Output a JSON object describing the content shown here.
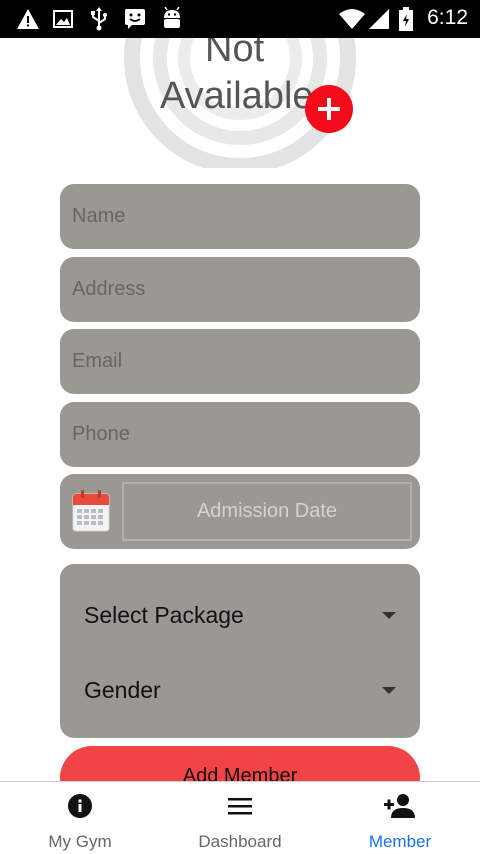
{
  "status_bar": {
    "time": "6:12",
    "icons": [
      "warning-icon",
      "image-icon",
      "usb-icon",
      "chat-icon",
      "android-icon",
      "wifi-icon",
      "signal-icon",
      "battery-icon"
    ]
  },
  "header": {
    "image_text_line1": "Not",
    "image_text_line2": "Available",
    "add_photo_icon": "plus-icon"
  },
  "form": {
    "name_placeholder": "Name",
    "address_placeholder": "Address",
    "email_placeholder": "Email",
    "phone_placeholder": "Phone",
    "admission_date_placeholder": "Admission Date",
    "select_package": "Select Package",
    "gender": "Gender",
    "add_member_label": "Add Member"
  },
  "bottom_nav": {
    "items": [
      {
        "label": "My Gym",
        "icon": "info-icon"
      },
      {
        "label": "Dashboard",
        "icon": "menu-icon"
      },
      {
        "label": "Member",
        "icon": "add-person-icon"
      }
    ],
    "active_index": 2
  },
  "colors": {
    "field_background": "#9b9894",
    "accent_red": "#f40b1a",
    "button_red": "#f24346",
    "active_nav": "#1a73e8",
    "inactive_nav": "#666666"
  }
}
